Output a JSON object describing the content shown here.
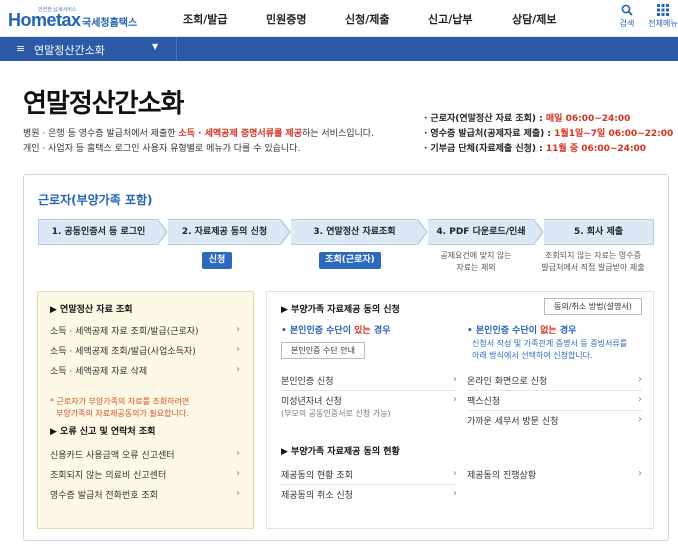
{
  "header": {
    "logo_small": "안전한 납세서비스",
    "logo_main": "Hometax",
    "logo_sub": "국세청홈택스",
    "menu": [
      "조회/발급",
      "민원증명",
      "신청/제출",
      "신고/납부",
      "상담/제보"
    ],
    "search_label": "검색",
    "allmenu_label": "전체메뉴"
  },
  "subbar": {
    "title": "연말정산간소화"
  },
  "page": {
    "title": "연말정산간소화",
    "desc1_a": "병원 · 은행 등 영수증 발급처에서 제출한 ",
    "desc1_hl": "소득 · 세액공제 증명서류를 제공",
    "desc1_b": "하는 서비스입니다.",
    "desc2": "개인 · 사업자 등 홈택스 로그인 사용자 유형별로 메뉴가 다를 수 있습니다."
  },
  "schedule": [
    {
      "label": "근로자(연말정산 자료 조회) : ",
      "value": "매일 06:00~24:00"
    },
    {
      "label": "영수증 발급처(공제자료 제출) : ",
      "value": "1월1일~7일 06:00~22:00"
    },
    {
      "label": "기부금 단체(자료제출 신청) : ",
      "value": "11월 중 06:00~24:00"
    }
  ],
  "section": {
    "title": "근로자(부양가족 포함)"
  },
  "steps": [
    "1. 공동인증서 등 로그인",
    "2. 자료제공 동의 신청",
    "3. 연말정산 자료조회",
    "4. PDF 다운로드/인쇄",
    "5. 회사 제출"
  ],
  "step_actions": {
    "apply": "신청",
    "lookup": "조회(근로자)"
  },
  "step_notes": {
    "pdf_1": "공제요건에 맞지 않는",
    "pdf_2": "자료는 제외",
    "submit_1": "조회되지 않는 자료는 영수증",
    "submit_2": "발급처에서 직접 발급받아 제출"
  },
  "left": {
    "head1": "▶ 연말정산 자료 조회",
    "items1": [
      "소득 · 세액공제 자료 조회/발급(근로자)",
      "소득 · 세액공제 조회/발급(사업소득자)",
      "소득 · 세액공제 자료 삭제"
    ],
    "note1": "* 근로자가 부양가족의 자료를 조회하려면",
    "note2": "부양가족의 자료제공동의가 필요합니다.",
    "head2": "▶ 오류 신고 및 연락처 조회",
    "items2": [
      "신용카드 사용금액 오류 신고센터",
      "조회되지 않는 의료비 신고센터",
      "영수증 발급처 전화번호 조회"
    ]
  },
  "right": {
    "head1": "▶ 부양가족 자료제공 동의 신청",
    "method_btn": "동의/취소 방법(설명서)",
    "auth_yes_pre": "• 본인인증 수단이 ",
    "auth_yes_hl": "있는",
    "auth_yes_post": " 경우",
    "auth_guide_btn": "본인인증 수단 안내",
    "auth_no_pre": "• 본인인증 수단이 ",
    "auth_no_hl": "없는",
    "auth_no_post": " 경우",
    "no_note1": "신청서 작성 및 가족관계 증명서 등 증빙서류를",
    "no_note2": "아래 방식에서 선택하여 신청합니다.",
    "items_left": [
      "본인인증 신청",
      "미성년자녀 신청"
    ],
    "minor_sub": "(부모의 공동인증서로 신청 가능)",
    "items_right": [
      "온라인 화면으로 신청",
      "팩스신청",
      "가까운 세무서 방문 신청"
    ],
    "head2": "▶ 부양가족 자료제공 동의 현황",
    "status_left": [
      "제공동의 현황 조회",
      "제공동의 취소 신청"
    ],
    "status_right": [
      "제공동의 진행상황"
    ]
  },
  "colors": {
    "brand": "#2c5aa8",
    "accent_red": "#d6301f",
    "step_bg": "#dbe9f7",
    "panel_yellow": "#fdf9e6"
  }
}
